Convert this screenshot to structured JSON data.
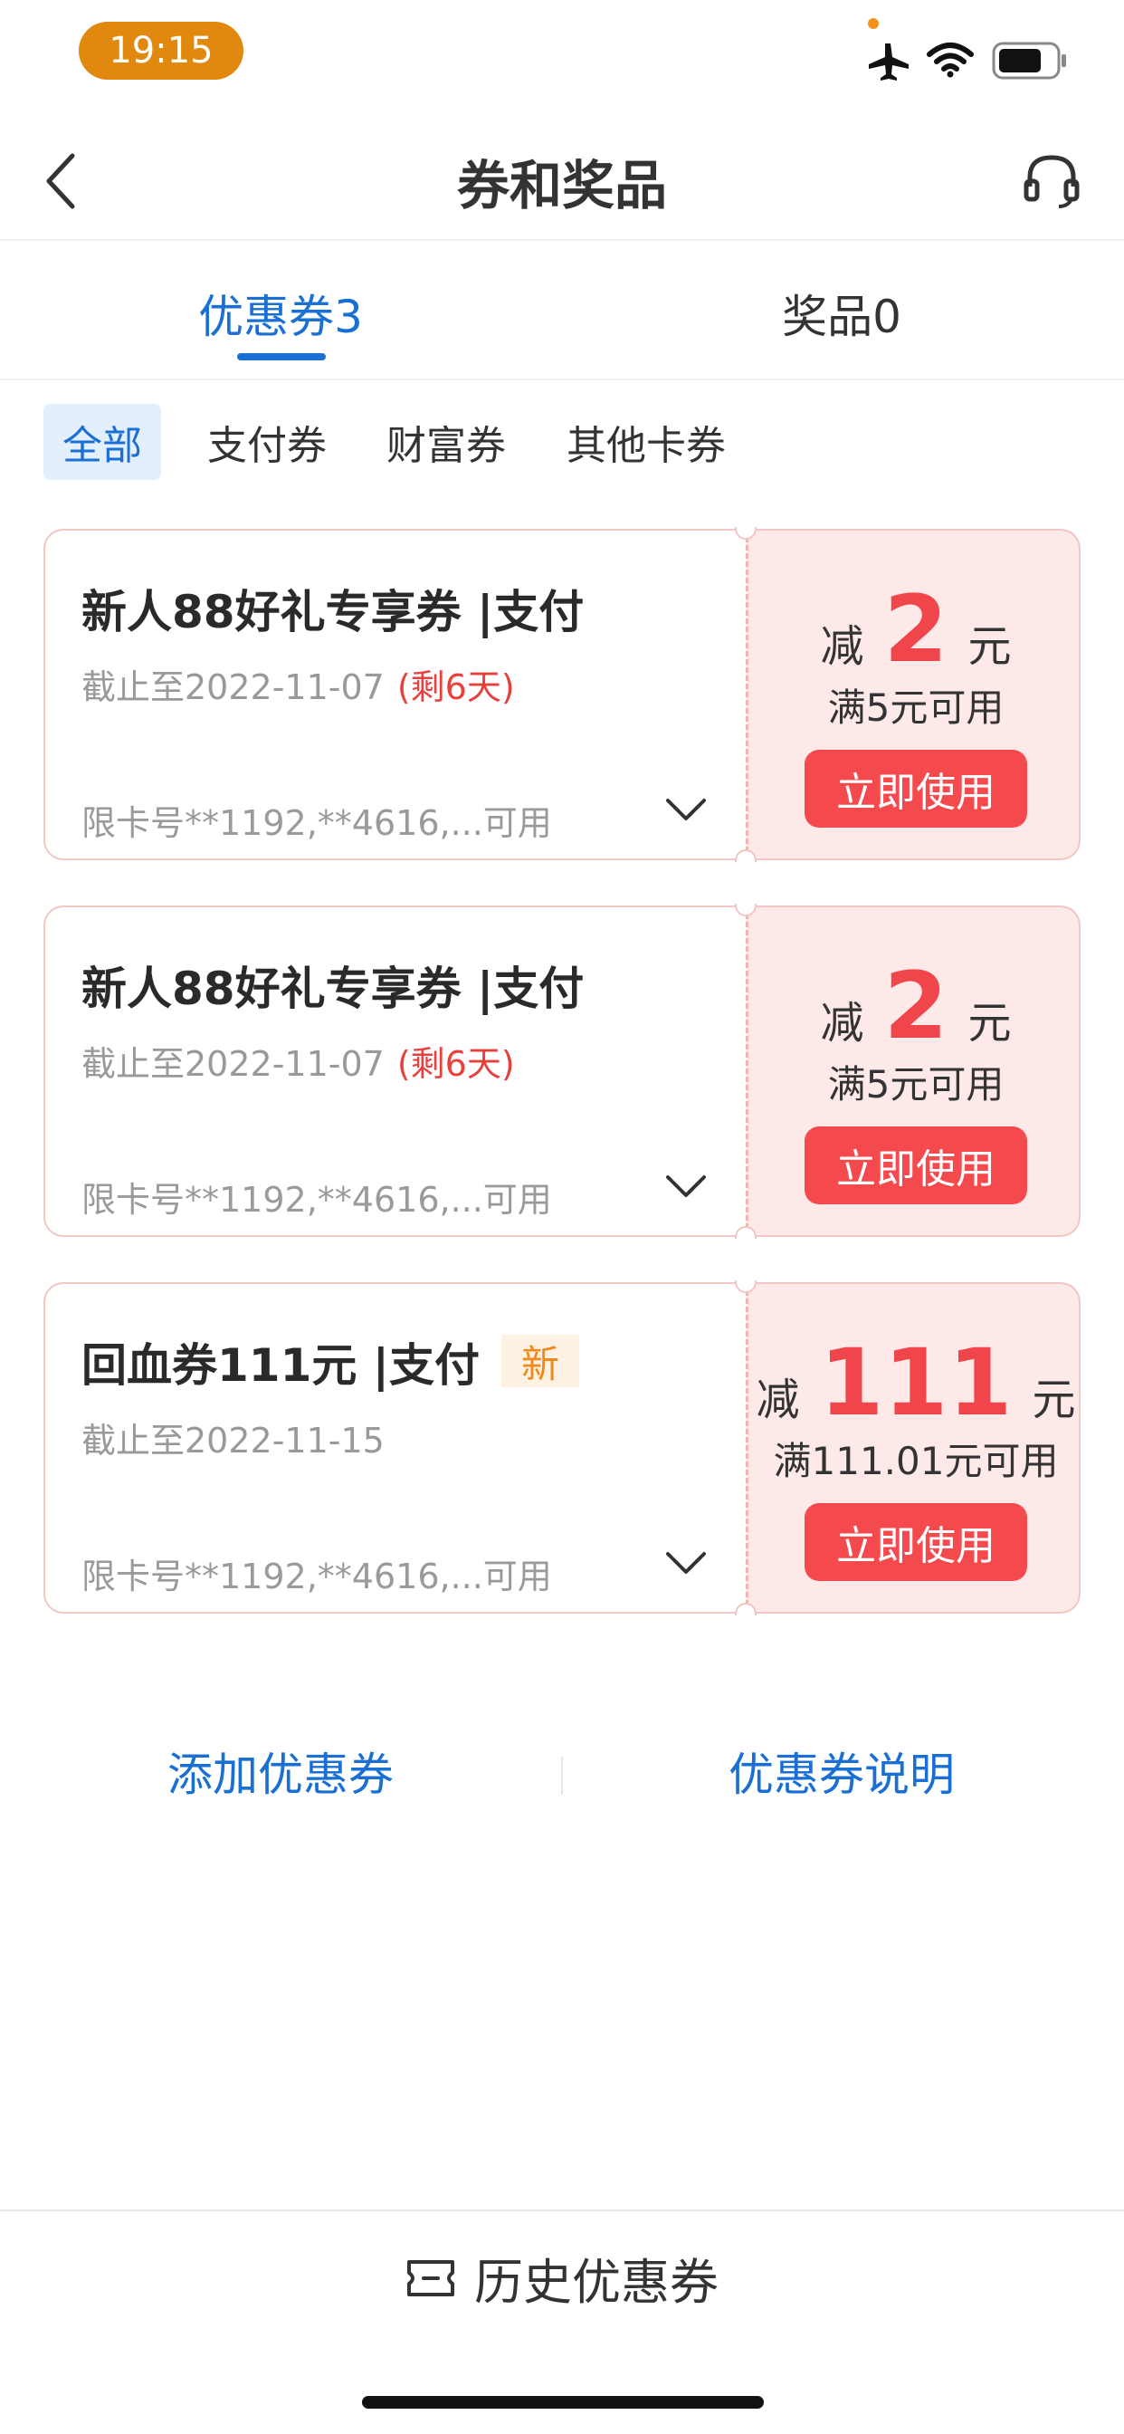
{
  "status_bar": {
    "time": "19:15"
  },
  "nav": {
    "title": "券和奖品"
  },
  "tabs": [
    {
      "label": "优惠券3"
    },
    {
      "label": "奖品0"
    }
  ],
  "filters": [
    {
      "label": "全部"
    },
    {
      "label": "支付券"
    },
    {
      "label": "财富券"
    },
    {
      "label": "其他卡券"
    }
  ],
  "coupons": [
    {
      "title": "新人88好礼专享券 |支付",
      "date": "截止至2022-11-07",
      "remain": "(剩6天)",
      "limit": "限卡号**1192,**4616,...可用",
      "prefix": "减",
      "amount": "2",
      "unit": "元",
      "condition": "满5元可用",
      "button": "立即使用"
    },
    {
      "title": "新人88好礼专享券 |支付",
      "date": "截止至2022-11-07",
      "remain": "(剩6天)",
      "limit": "限卡号**1192,**4616,...可用",
      "prefix": "减",
      "amount": "2",
      "unit": "元",
      "condition": "满5元可用",
      "button": "立即使用"
    },
    {
      "title": "回血券111元 |支付",
      "badge": "新",
      "date": "截止至2022-11-15",
      "limit": "限卡号**1192,**4616,...可用",
      "prefix": "减",
      "amount": "111",
      "unit": "元",
      "condition": "满111.01元可用",
      "button": "立即使用"
    }
  ],
  "links": {
    "add": "添加优惠券",
    "explain": "优惠券说明"
  },
  "history": {
    "label": "历史优惠券"
  },
  "colors": {
    "accent": "#1a6fd4",
    "coupon_red": "#f0454a",
    "button_red": "#f4494d",
    "time_pill": "#e0890e"
  },
  "icons": [
    "airplane-icon",
    "wifi-icon",
    "battery-icon",
    "back-icon",
    "headset-icon",
    "chevron-down-icon",
    "ticket-icon"
  ]
}
